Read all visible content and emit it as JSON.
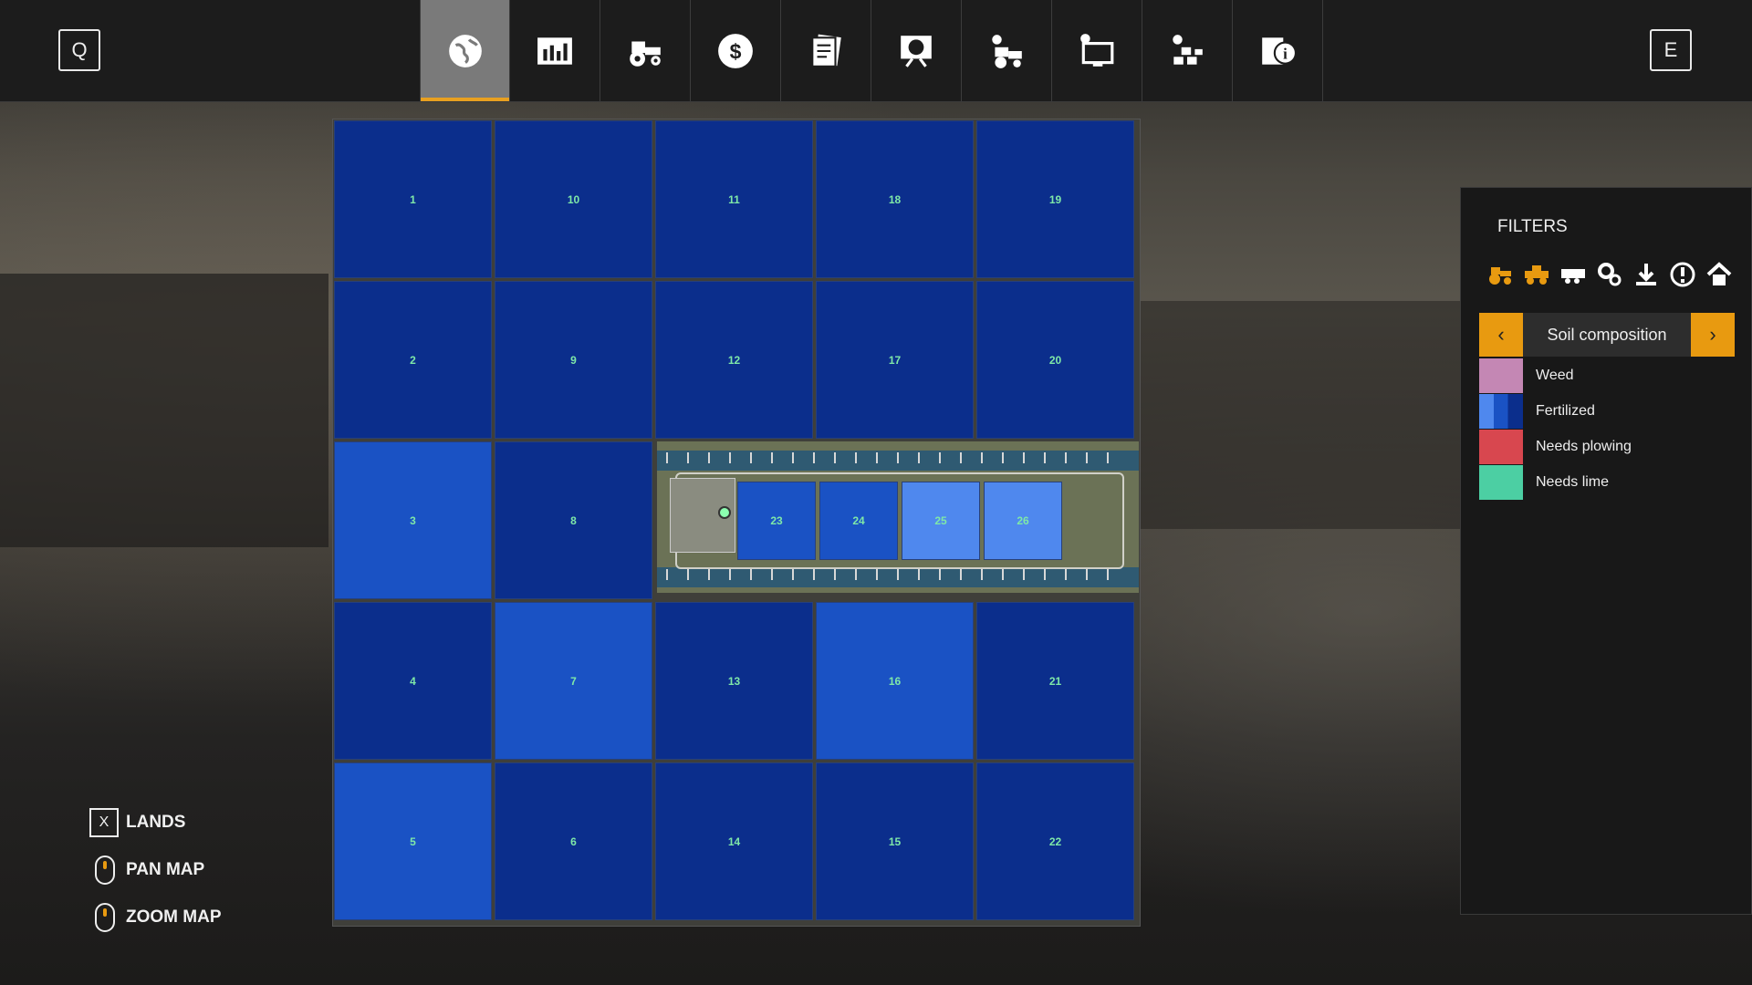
{
  "topbar": {
    "left_key": "Q",
    "right_key": "E",
    "tabs": [
      {
        "icon": "globe-icon",
        "active": true
      },
      {
        "icon": "stats-chart-icon",
        "active": false
      },
      {
        "icon": "tractor-icon",
        "active": false
      },
      {
        "icon": "dollar-icon",
        "active": false
      },
      {
        "icon": "contracts-icon",
        "active": false
      },
      {
        "icon": "price-board-icon",
        "active": false
      },
      {
        "icon": "vehicle-settings-icon",
        "active": false
      },
      {
        "icon": "display-settings-icon",
        "active": false
      },
      {
        "icon": "production-icon",
        "active": false
      },
      {
        "icon": "help-info-icon",
        "active": false
      }
    ]
  },
  "map": {
    "fields": [
      {
        "label": "1",
        "color": "dark"
      },
      {
        "label": "10",
        "color": "dark"
      },
      {
        "label": "11",
        "color": "dark"
      },
      {
        "label": "18",
        "color": "dark"
      },
      {
        "label": "19",
        "color": "dark"
      },
      {
        "label": "2",
        "color": "dark"
      },
      {
        "label": "9",
        "color": "dark"
      },
      {
        "label": "12",
        "color": "dark"
      },
      {
        "label": "17",
        "color": "dark"
      },
      {
        "label": "20",
        "color": "dark"
      },
      {
        "label": "3",
        "color": "mid"
      },
      {
        "label": "8",
        "color": "dark"
      },
      {
        "label": "4",
        "color": "dark"
      },
      {
        "label": "7",
        "color": "mid"
      },
      {
        "label": "13",
        "color": "dark"
      },
      {
        "label": "16",
        "color": "mid"
      },
      {
        "label": "21",
        "color": "dark"
      },
      {
        "label": "5",
        "color": "mid"
      },
      {
        "label": "6",
        "color": "dark"
      },
      {
        "label": "14",
        "color": "dark"
      },
      {
        "label": "15",
        "color": "dark"
      },
      {
        "label": "22",
        "color": "dark"
      },
      {
        "label": "23",
        "color": "mid"
      },
      {
        "label": "24",
        "color": "mid"
      },
      {
        "label": "25",
        "color": "light"
      },
      {
        "label": "26",
        "color": "light"
      }
    ]
  },
  "filters": {
    "title": "FILTERS",
    "icons": [
      "tractor-filter-icon",
      "harvester-filter-icon",
      "trailer-filter-icon",
      "tools-filter-icon",
      "sell-point-filter-icon",
      "warning-filter-icon",
      "farmhouse-filter-icon"
    ],
    "selector": {
      "prev": "‹",
      "label": "Soil composition",
      "next": "›"
    },
    "legend": [
      {
        "label": "Weed",
        "color": "#c487b4"
      },
      {
        "label": "Fertilized",
        "color": "#1f55c8"
      },
      {
        "label": "Needs plowing",
        "color": "#d8474f"
      },
      {
        "label": "Needs lime",
        "color": "#4ccfa3"
      }
    ]
  },
  "hints": [
    {
      "key": "X",
      "label": "LANDS"
    },
    {
      "label": "PAN MAP"
    },
    {
      "label": "ZOOM MAP"
    }
  ],
  "colors": {
    "accent": "#e89a10",
    "field_dark": "#0b2e8c",
    "field_mid": "#1a52c4",
    "field_light": "#4f88ee",
    "field_label": "#7fe8a8"
  }
}
